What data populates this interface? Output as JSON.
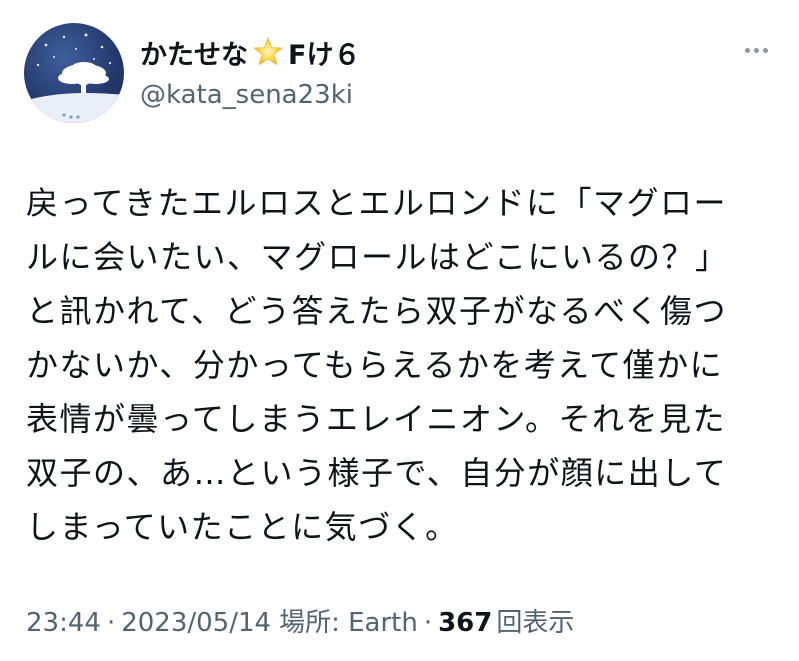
{
  "user": {
    "display_name": "かたせな",
    "name_emoji": "star-emoji",
    "display_name_suffix": "Fけ６",
    "handle": "@kata_sena23ki"
  },
  "tweet": {
    "lines": [
      "戻ってきたエルロスとエルロンドに「マグロー",
      "ルに会いたい、マグロールはどこにいるの？」",
      "と訊かれて、どう答えたら双子がなるべく傷つ",
      "かないか、分かってもらえるかを考えて僅かに",
      "表情が曇ってしまうエレイニオン。それを見た",
      "双子の、あ…という様子で、自分が顔に出して",
      "しまっていたことに気づく。"
    ]
  },
  "meta": {
    "time": "23:44",
    "separator": "·",
    "date": "2023/05/14",
    "location": "場所: Earth",
    "views_count": "367",
    "views_label": "回表示"
  },
  "colors": {
    "text": "#0f1419",
    "secondary": "#536471",
    "avatar_bg": "#23386b"
  }
}
